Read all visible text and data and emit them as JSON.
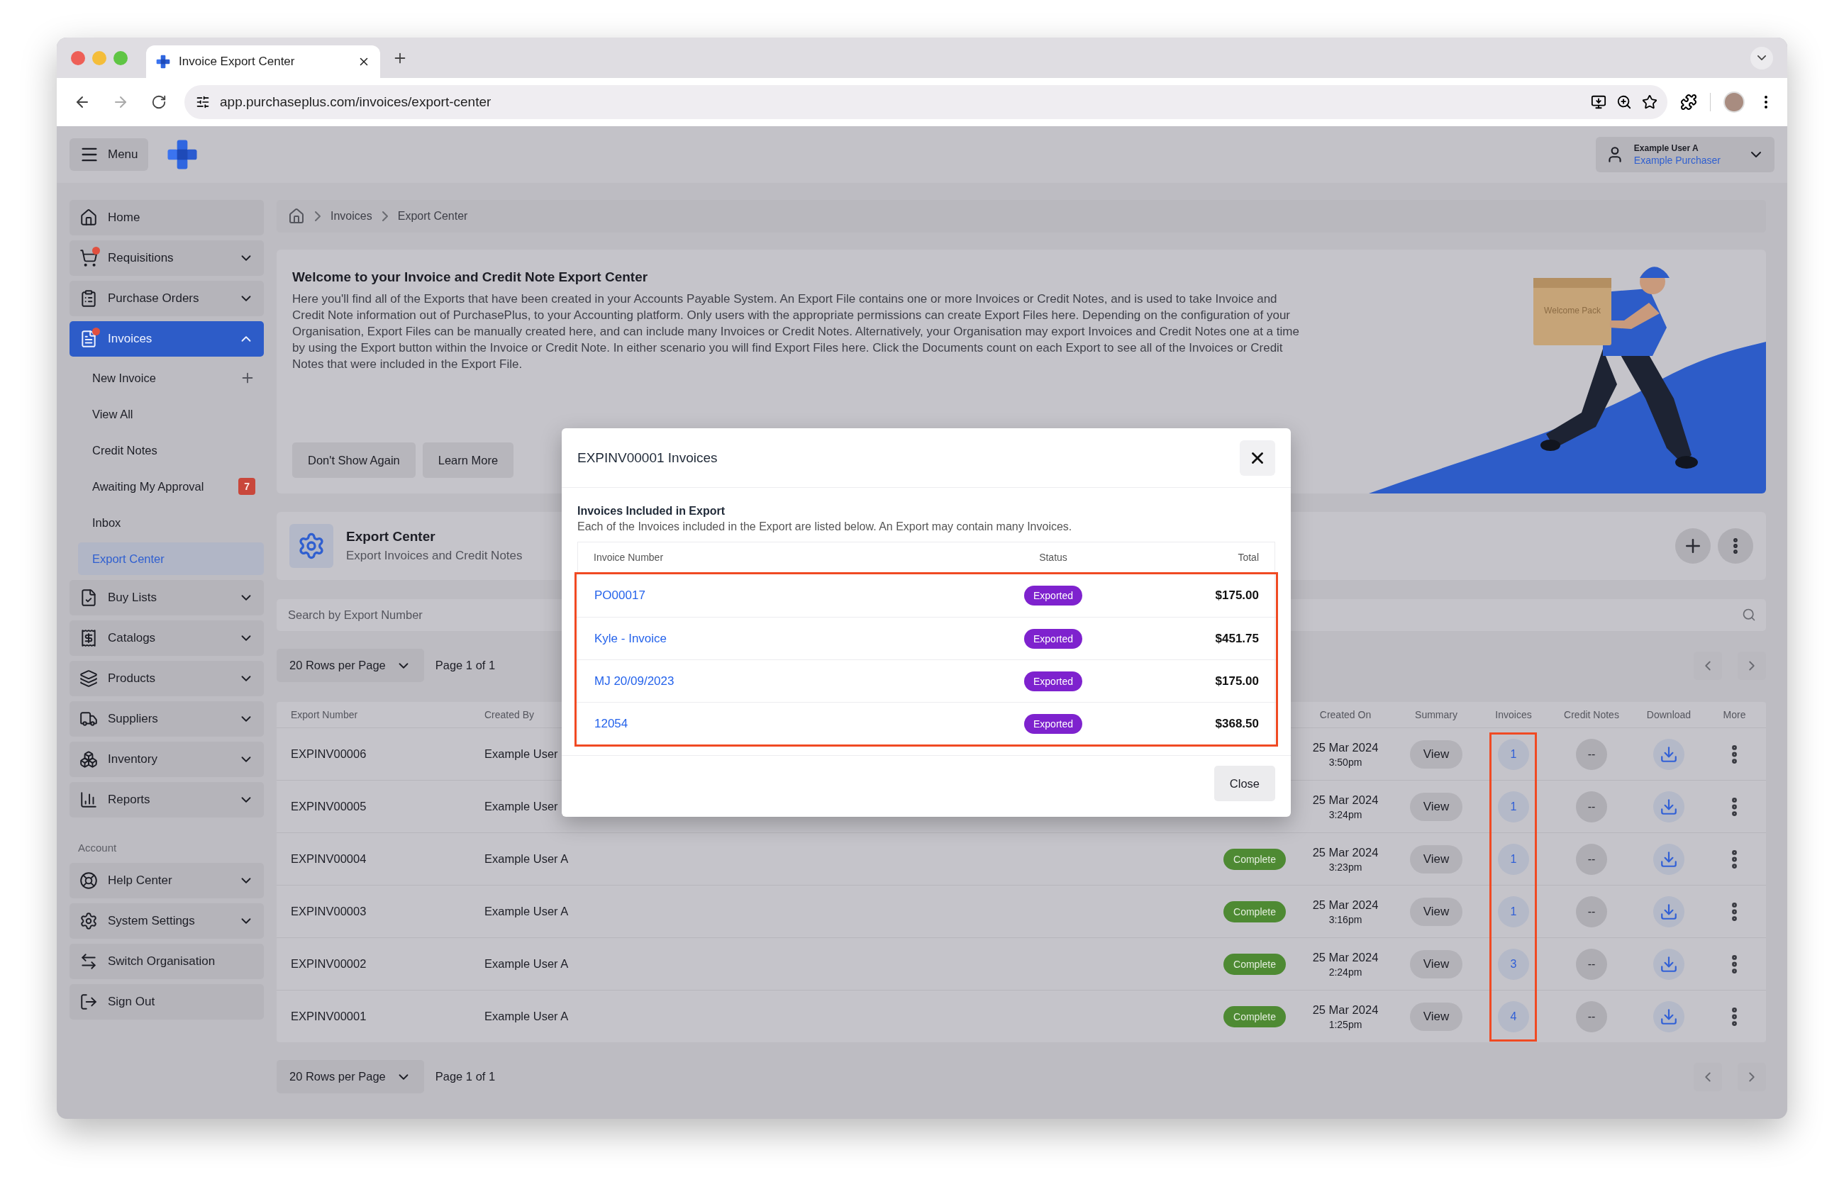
{
  "browser": {
    "tab_title": "Invoice Export Center",
    "url": "app.purchaseplus.com/invoices/export-center"
  },
  "header": {
    "menu_label": "Menu",
    "user_name": "Example User A",
    "user_role": "Example Purchaser"
  },
  "sidebar": {
    "items": [
      {
        "label": "Home",
        "selected": false,
        "notification": false
      },
      {
        "label": "Requisitions",
        "selected": false,
        "notification": true,
        "expanded": false
      },
      {
        "label": "Purchase Orders",
        "selected": false,
        "notification": false,
        "expanded": false
      },
      {
        "label": "Invoices",
        "selected": true,
        "notification": true,
        "expanded": true,
        "children": [
          {
            "label": "New Invoice",
            "kind": "add",
            "selected": false
          },
          {
            "label": "View All",
            "kind": "link",
            "selected": false
          },
          {
            "label": "Credit Notes",
            "kind": "link",
            "selected": false
          },
          {
            "label": "Awaiting My Approval",
            "kind": "link",
            "selected": false,
            "badge": "7"
          },
          {
            "label": "Inbox",
            "kind": "link",
            "selected": false
          },
          {
            "label": "Export Center",
            "kind": "link",
            "selected": true
          }
        ]
      },
      {
        "label": "Buy Lists",
        "selected": false,
        "notification": false,
        "expanded": false
      },
      {
        "label": "Catalogs",
        "selected": false,
        "notification": false,
        "expanded": false
      },
      {
        "label": "Products",
        "selected": false,
        "notification": false,
        "expanded": false
      },
      {
        "label": "Suppliers",
        "selected": false,
        "notification": false,
        "expanded": false
      },
      {
        "label": "Inventory",
        "selected": false,
        "notification": false,
        "expanded": false
      },
      {
        "label": "Reports",
        "selected": false,
        "notification": false,
        "expanded": false
      }
    ],
    "account_label": "Account",
    "account_items": [
      {
        "label": "Help Center",
        "selected": false,
        "notification": false,
        "expanded": false
      },
      {
        "label": "System Settings",
        "selected": false,
        "notification": false,
        "expanded": false
      },
      {
        "label": "Switch Organisation",
        "selected": false,
        "notification": false
      },
      {
        "label": "Sign Out",
        "selected": false,
        "notification": false
      }
    ]
  },
  "breadcrumb": [
    "Invoices",
    "Export Center"
  ],
  "welcome": {
    "title": "Welcome to your Invoice and Credit Note Export Center",
    "text": "Here you'll find all of the Exports that have been created in your Accounts Payable System. An Export File contains one or more Invoices or Credit Notes, and is used to take Invoice and Credit Note information out of PurchasePlus, to your Accounting platform. Only users with the appropriate permissions can create Export Files here. Depending on the configuration of your Organisation, Export Files can be manually created here, and can include many Invoices or Credit Notes. Alternatively, your Organisation may export Invoices and Credit Notes one at a time by using the Export button within the Invoice or Credit Note. In either scenario you will find Export Files here. Click the Documents count on each Export to see all of the Invoices or Credit Notes that were included in the Export File.",
    "buttons": [
      "Don't Show Again",
      "Learn More"
    ],
    "box_label": "Welcome Pack"
  },
  "export_header": {
    "title": "Export Center",
    "subtitle": "Export Invoices and Credit Notes"
  },
  "search": {
    "placeholder": "Search by Export Number"
  },
  "pagination_top": {
    "rows_per_page": "20 Rows per Page",
    "page": "Page 1 of 1"
  },
  "table": {
    "columns": [
      {
        "kind": "export_number",
        "label": "Export Number"
      },
      {
        "kind": "created_by",
        "label": "Created By"
      },
      {
        "kind": "created_on",
        "label": "Created On"
      },
      {
        "kind": "summary",
        "label": "Summary"
      },
      {
        "kind": "invoices",
        "label": "Invoices"
      },
      {
        "kind": "credit_notes",
        "label": "Credit Notes"
      },
      {
        "kind": "download",
        "label": "Download"
      },
      {
        "kind": "more",
        "label": "More"
      }
    ],
    "rows": [
      {
        "export_number": "EXPINV00006",
        "created_by": "Example User",
        "date": "25 Mar 2024",
        "time": "3:50pm",
        "summary": "View",
        "invoices": "1",
        "credit_notes": "--"
      },
      {
        "export_number": "EXPINV00005",
        "created_by": "Example User",
        "date": "25 Mar 2024",
        "time": "3:24pm",
        "summary": "View",
        "invoices": "1",
        "credit_notes": "--"
      },
      {
        "export_number": "EXPINV00004",
        "created_by": "Example User A",
        "status": "Complete",
        "date": "25 Mar 2024",
        "time": "3:23pm",
        "summary": "View",
        "invoices": "1",
        "credit_notes": "--"
      },
      {
        "export_number": "EXPINV00003",
        "created_by": "Example User A",
        "status": "Complete",
        "date": "25 Mar 2024",
        "time": "3:16pm",
        "summary": "View",
        "invoices": "1",
        "credit_notes": "--"
      },
      {
        "export_number": "EXPINV00002",
        "created_by": "Example User A",
        "status": "Complete",
        "date": "25 Mar 2024",
        "time": "2:24pm",
        "summary": "View",
        "invoices": "3",
        "credit_notes": "--"
      },
      {
        "export_number": "EXPINV00001",
        "created_by": "Example User A",
        "status": "Complete",
        "date": "25 Mar 2024",
        "time": "1:25pm",
        "summary": "View",
        "invoices": "4",
        "credit_notes": "--"
      }
    ]
  },
  "pagination_bottom": {
    "rows_per_page": "20 Rows per Page",
    "page": "Page 1 of 1"
  },
  "modal": {
    "title": "EXPINV00001 Invoices",
    "section_title": "Invoices Included in Export",
    "description": "Each of the Invoices included in the Export are listed below. An Export may contain many Invoices.",
    "columns": [
      "Invoice Number",
      "Status",
      "Total"
    ],
    "rows": [
      {
        "number": "PO00017",
        "status": "Exported",
        "total": "$175.00"
      },
      {
        "number": "Kyle - Invoice",
        "status": "Exported",
        "total": "$451.75"
      },
      {
        "number": "MJ 20/09/2023",
        "status": "Exported",
        "total": "$175.00"
      },
      {
        "number": "12054",
        "status": "Exported",
        "total": "$368.50"
      }
    ],
    "close_button": "Close"
  }
}
